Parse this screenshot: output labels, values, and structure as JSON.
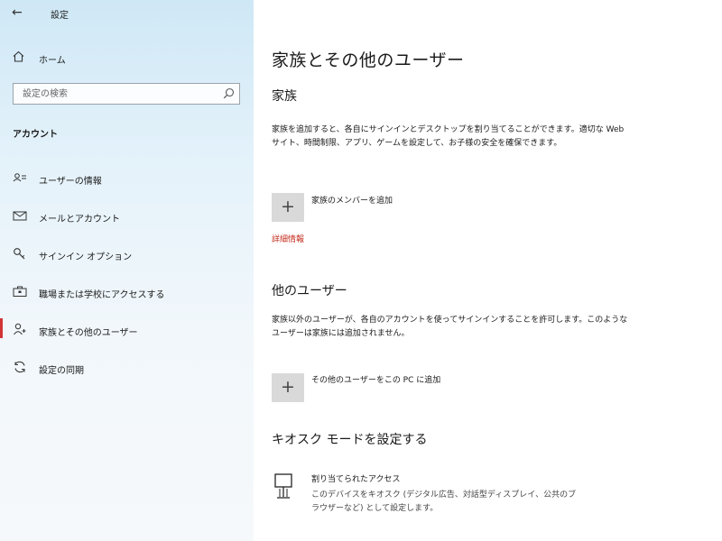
{
  "sidebar": {
    "back_icon": "←",
    "app_title": "設定",
    "home_label": "ホーム",
    "search_placeholder": "設定の検索",
    "section_title": "アカウント",
    "items": [
      {
        "label": "ユーザーの情報",
        "icon": "user-info-icon"
      },
      {
        "label": "メールとアカウント",
        "icon": "mail-icon"
      },
      {
        "label": "サインイン オプション",
        "icon": "key-icon"
      },
      {
        "label": "職場または学校にアクセスする",
        "icon": "briefcase-icon"
      },
      {
        "label": "家族とその他のユーザー",
        "icon": "person-icon",
        "active": true
      },
      {
        "label": "設定の同期",
        "icon": "sync-icon"
      }
    ],
    "accent_color": "#d13438"
  },
  "main": {
    "title": "家族とその他のユーザー",
    "family": {
      "heading": "家族",
      "description": "家族を追加すると、各自にサインインとデスクトップを割り当てることができます。適切な Web サイト、時間制限、アプリ、ゲームを設定して、お子様の安全を確保できます。",
      "add_label": "家族のメンバーを追加",
      "link": "詳細情報"
    },
    "others": {
      "heading": "他のユーザー",
      "description": "家族以外のユーザーが、各自のアカウントを使ってサインインすることを許可します。このようなユーザーは家族には追加されません。",
      "add_label": "その他のユーザーをこの PC に追加"
    },
    "kiosk": {
      "heading": "キオスク モードを設定する",
      "title": "割り当てられたアクセス",
      "description": "このデバイスをキオスク (デジタル広告、対話型ディスプレイ、公共のブラウザーなど) として設定します。"
    }
  }
}
